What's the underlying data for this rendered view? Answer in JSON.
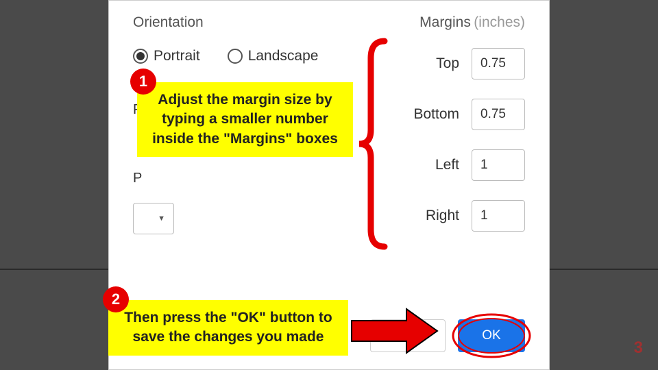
{
  "orientation": {
    "title": "Orientation",
    "portrait_label": "Portrait",
    "landscape_label": "Landscape"
  },
  "margins": {
    "title": "Margins",
    "unit": "(inches)",
    "rows": [
      {
        "label": "Top",
        "value": "0.75"
      },
      {
        "label": "Bottom",
        "value": "0.75"
      },
      {
        "label": "Left",
        "value": "1"
      },
      {
        "label": "Right",
        "value": "1"
      }
    ]
  },
  "field_letters": {
    "p1": "P",
    "p2": "P"
  },
  "buttons": {
    "cancel": "",
    "ok": "OK"
  },
  "callouts": {
    "c1": "Adjust the margin size by typing a smaller number inside the \"Margins\" boxes",
    "c2": "Then press the \"OK\" button to save the changes you made"
  },
  "badges": {
    "b1": "1",
    "b2": "2"
  },
  "page_number": "3"
}
